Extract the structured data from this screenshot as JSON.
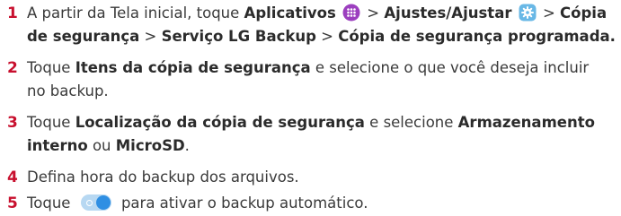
{
  "colors": {
    "step_number": "#c8102e",
    "body_text": "#3a3a3a",
    "apps_icon": "#9c3fbf",
    "settings_icon": "#69b8e6",
    "toggle_track": "#b7d8f2",
    "toggle_knob": "#2f8fe3"
  },
  "steps": [
    {
      "number": "1",
      "t1": "A partir da Tela inicial, toque ",
      "b1": "Aplicativos",
      "icon1": "apps-icon",
      "t2": " > ",
      "b2": "Ajustes/Ajustar",
      "icon2": "settings-gear-icon",
      "t3": " > ",
      "b3": "Cópia",
      "b4": "de segurança",
      "t4": " > ",
      "b5": "Serviço LG Backup",
      "t5": " > ",
      "b6": "Cópia de segurança programada."
    },
    {
      "number": "2",
      "t1": "Toque ",
      "b1": "Itens da cópia de segurança",
      "t2": " e selecione o que você deseja incluir",
      "t3": "no backup."
    },
    {
      "number": "3",
      "t1": "Toque ",
      "b1": "Localização da cópia de segurança",
      "t2": " e selecione ",
      "b2": "Armazenamento",
      "b3": "interno",
      "t3": " ou ",
      "b4": "MicroSD",
      "t4": "."
    },
    {
      "number": "4",
      "t1": "Defina hora do backup dos arquivos."
    },
    {
      "number": "5",
      "t1": "Toque ",
      "icon1": "toggle-switch-icon",
      "t2": " para ativar o backup automático."
    }
  ]
}
